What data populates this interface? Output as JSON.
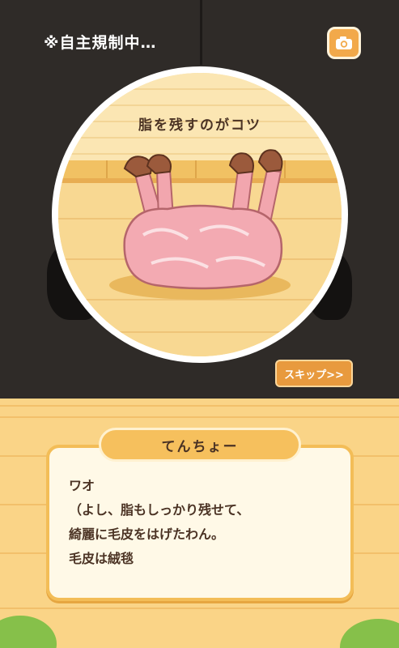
{
  "header": {
    "censor_notice": "※自主規制中…",
    "camera_icon": "camera-icon"
  },
  "scene": {
    "caption": "脂を残すのがコツ",
    "illustration": "skinned-carcass-on-wooden-floor"
  },
  "controls": {
    "skip_label": "スキップ>>"
  },
  "dialog": {
    "speaker": "てんちょー",
    "lines": [
      "ワオ",
      "（よし、脂もしっかり残せて、",
      "綺麗に毛皮をはげたわん。",
      "毛皮は絨毯"
    ]
  },
  "colors": {
    "background_dark": "#2f2b28",
    "floor": "#fad487",
    "accent_orange": "#e89a3e",
    "text_brown": "#4b3324"
  }
}
